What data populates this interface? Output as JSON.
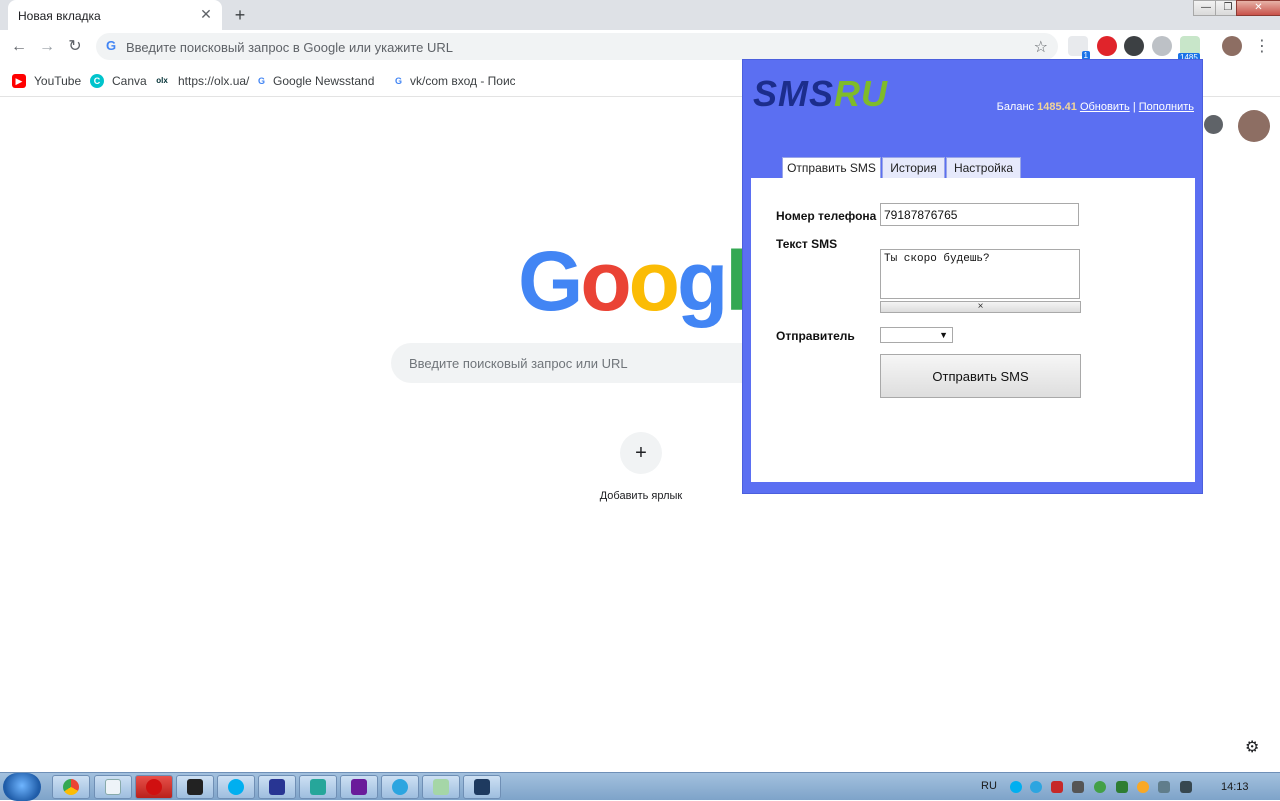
{
  "browser": {
    "tab_title": "Новая вкладка",
    "tab_close": "✕",
    "new_tab": "+",
    "window_controls": {
      "minimize": "—",
      "maximize": "❐",
      "close": "✕"
    },
    "omnibox_placeholder": "Введите поисковый запрос в Google или укажите URL",
    "extension_badges": {
      "counter": "1",
      "sms_balance": "1485"
    },
    "bookmarks": [
      {
        "label": "YouTube",
        "icon": "youtube-icon",
        "color": "#ff0000"
      },
      {
        "label": "Canva",
        "icon": "canva-icon",
        "color": "#00c4cc"
      },
      {
        "label": "https://olx.ua/",
        "icon": "olx-icon",
        "color": "#002f34"
      },
      {
        "label": "Google Newsstand р",
        "icon": "google-icon",
        "color": "#4285f4"
      },
      {
        "label": "vk/com вход - Поиск",
        "icon": "google-icon",
        "color": "#4285f4"
      }
    ]
  },
  "ntp": {
    "logo": "Google",
    "search_placeholder": "Введите поисковый запрос или URL",
    "add_shortcut_plus": "+",
    "add_shortcut_label": "Добавить ярлык"
  },
  "sms_popup": {
    "logo_sms": "SMS",
    "logo_ru": "RU",
    "balance_label": "Баланс",
    "balance_value": "1485.41",
    "refresh_link": "Обновить",
    "separator": "|",
    "topup_link": "Пополнить",
    "tabs": [
      {
        "label": "Отправить SMS",
        "active": true
      },
      {
        "label": "История",
        "active": false
      },
      {
        "label": "Настройка",
        "active": false
      }
    ],
    "phone_label": "Номер телефона",
    "phone_value": "79187876765",
    "text_label": "Текст SMS",
    "text_value": "Ты скоро будешь?",
    "clear_symbol": "×",
    "sender_label": "Отправитель",
    "sender_arrow": "▼",
    "send_button": "Отправить SMS"
  },
  "taskbar": {
    "language": "RU",
    "clock": "14:13"
  },
  "colors": {
    "popup_bg": "#5b6ff2",
    "balance_value": "#f2d59a",
    "logo_sms": "#1c2d8c",
    "logo_ru": "#7fbb2a"
  }
}
